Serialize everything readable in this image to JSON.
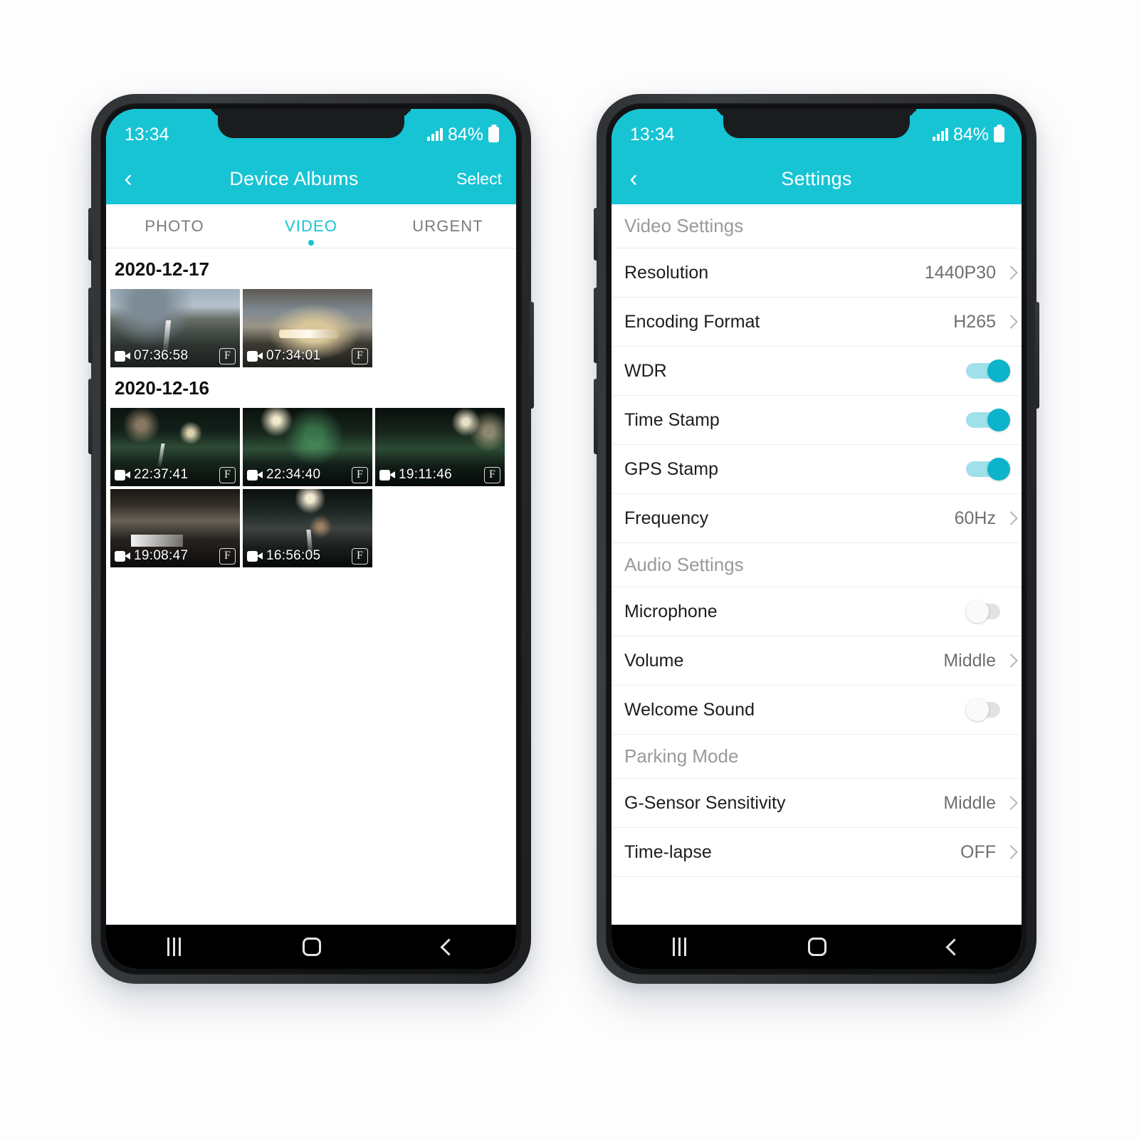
{
  "status_bar": {
    "time": "13:34",
    "battery": "84%",
    "signal_icon": "signal-bars-icon",
    "battery_icon": "battery-icon"
  },
  "theme": {
    "accent": "#16c4d4",
    "toggle_on_knob": "#0db3cb",
    "toggle_on_track": "#9fe0ea",
    "toggle_off": "#e2e2e2"
  },
  "album_phone": {
    "appbar": {
      "back_icon": "chevron-left-icon",
      "title": "Device Albums",
      "action": "Select"
    },
    "tabs": [
      {
        "label": "PHOTO",
        "active": false
      },
      {
        "label": "VIDEO",
        "active": true
      },
      {
        "label": "URGENT",
        "active": false
      }
    ],
    "groups": [
      {
        "date": "2020-12-17",
        "items": [
          {
            "time": "07:36:58",
            "badge": "F"
          },
          {
            "time": "07:34:01",
            "badge": "F"
          }
        ]
      },
      {
        "date": "2020-12-16",
        "items": [
          {
            "time": "22:37:41",
            "badge": "F"
          },
          {
            "time": "22:34:40",
            "badge": "F"
          },
          {
            "time": "19:11:46",
            "badge": "F"
          },
          {
            "time": "19:08:47",
            "badge": "F"
          },
          {
            "time": "16:56:05",
            "badge": "F"
          }
        ]
      }
    ]
  },
  "settings_phone": {
    "appbar": {
      "back_icon": "chevron-left-icon",
      "title": "Settings"
    },
    "sections": [
      {
        "header": "Video Settings",
        "rows": [
          {
            "label": "Resolution",
            "type": "value",
            "value": "1440P30"
          },
          {
            "label": "Encoding Format",
            "type": "value",
            "value": "H265"
          },
          {
            "label": "WDR",
            "type": "toggle",
            "value": "on"
          },
          {
            "label": "Time Stamp",
            "type": "toggle",
            "value": "on"
          },
          {
            "label": "GPS Stamp",
            "type": "toggle",
            "value": "on"
          },
          {
            "label": "Frequency",
            "type": "value",
            "value": "60Hz"
          }
        ]
      },
      {
        "header": "Audio Settings",
        "rows": [
          {
            "label": "Microphone",
            "type": "toggle",
            "value": "off"
          },
          {
            "label": "Volume",
            "type": "value",
            "value": "Middle"
          },
          {
            "label": "Welcome Sound",
            "type": "toggle",
            "value": "off"
          }
        ]
      },
      {
        "header": "Parking Mode",
        "rows": [
          {
            "label": "G-Sensor Sensitivity",
            "type": "value",
            "value": "Middle"
          },
          {
            "label": "Time-lapse",
            "type": "value",
            "value": "OFF"
          }
        ]
      }
    ]
  },
  "nav_bar": {
    "recent_icon": "recent-apps-icon",
    "home_icon": "home-icon",
    "back_icon": "back-icon"
  }
}
